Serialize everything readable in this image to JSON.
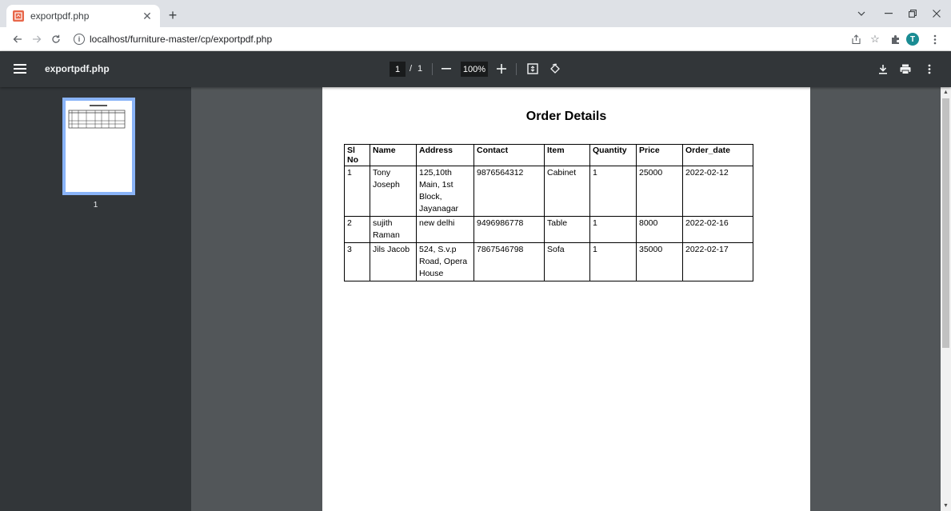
{
  "browser": {
    "tab_title": "exportpdf.php",
    "url": "localhost/furniture-master/cp/exportpdf.php",
    "profile_initial": "T"
  },
  "pdf_toolbar": {
    "title": "exportpdf.php",
    "current_page": "1",
    "page_separator": "/",
    "total_pages": "1",
    "zoom": "100%"
  },
  "sidebar": {
    "thumbnail_label": "1"
  },
  "document": {
    "title": "Order Details",
    "columns": [
      "Sl No",
      "Name",
      "Address",
      "Contact",
      "Item",
      "Quantity",
      "Price",
      "Order_date"
    ],
    "rows": [
      [
        "1",
        "Tony Joseph",
        "125,10th Main, 1st Block, Jayanagar",
        "9876564312",
        "Cabinet",
        "1",
        "25000",
        "2022-02-12"
      ],
      [
        "2",
        "sujith Raman",
        "new delhi",
        "9496986778",
        "Table",
        "1",
        "8000",
        "2022-02-16"
      ],
      [
        "3",
        "Jils Jacob",
        "524, S.v.p Road, Opera House",
        "7867546798",
        "Sofa",
        "1",
        "35000",
        "2022-02-17"
      ]
    ]
  }
}
